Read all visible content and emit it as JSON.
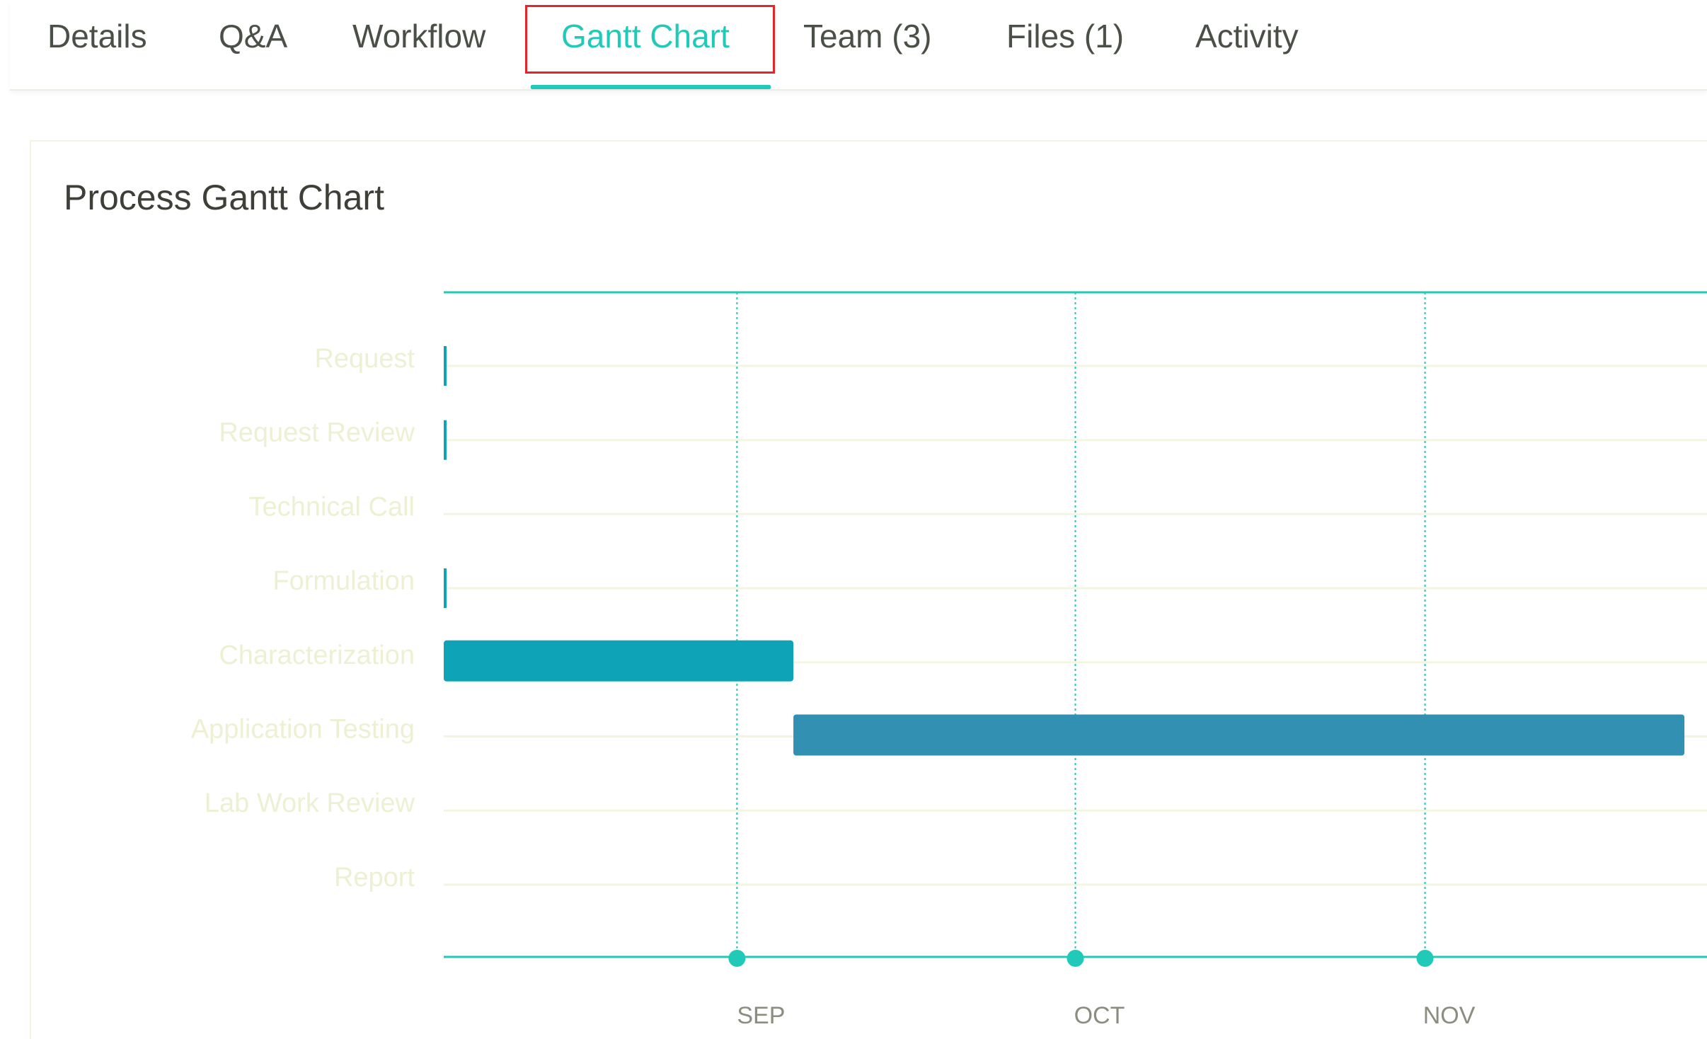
{
  "tabs": [
    {
      "label": "Details",
      "active": false
    },
    {
      "label": "Q&A",
      "active": false
    },
    {
      "label": "Workflow",
      "active": false
    },
    {
      "label": "Gantt Chart",
      "active": true
    },
    {
      "label": "Team (3)",
      "active": false
    },
    {
      "label": "Files (1)",
      "active": false
    },
    {
      "label": "Activity",
      "active": false
    }
  ],
  "card": {
    "title": "Process Gantt Chart"
  },
  "colors": {
    "accent": "#21c9b9",
    "bar_light": "#0fa3b8",
    "bar_dark": "#3290b3",
    "highlight_box": "#e4262b"
  },
  "chart_data": {
    "type": "gantt",
    "tasks": [
      {
        "name": "Request",
        "start": "2019-08-06",
        "end": "2019-08-06"
      },
      {
        "name": "Request Review",
        "start": "2019-08-06",
        "end": "2019-08-06"
      },
      {
        "name": "Technical Call",
        "start": null,
        "end": null
      },
      {
        "name": "Formulation",
        "start": "2019-08-06",
        "end": "2019-08-06"
      },
      {
        "name": "Characterization",
        "start": "2019-08-06",
        "end": "2019-09-06"
      },
      {
        "name": "Application Testing",
        "start": "2019-09-06",
        "end": "2019-11-24"
      }
    ],
    "extra_rows": [
      "Lab Work Review",
      "Report"
    ],
    "x_ticks": [
      {
        "label": "SEP",
        "date": "2019-09-01"
      },
      {
        "label": "OCT",
        "date": "2019-10-01"
      },
      {
        "label": "NOV",
        "date": "2019-11-01"
      }
    ],
    "x_range": [
      "2019-08-06",
      "2019-11-26"
    ],
    "grid": true
  }
}
